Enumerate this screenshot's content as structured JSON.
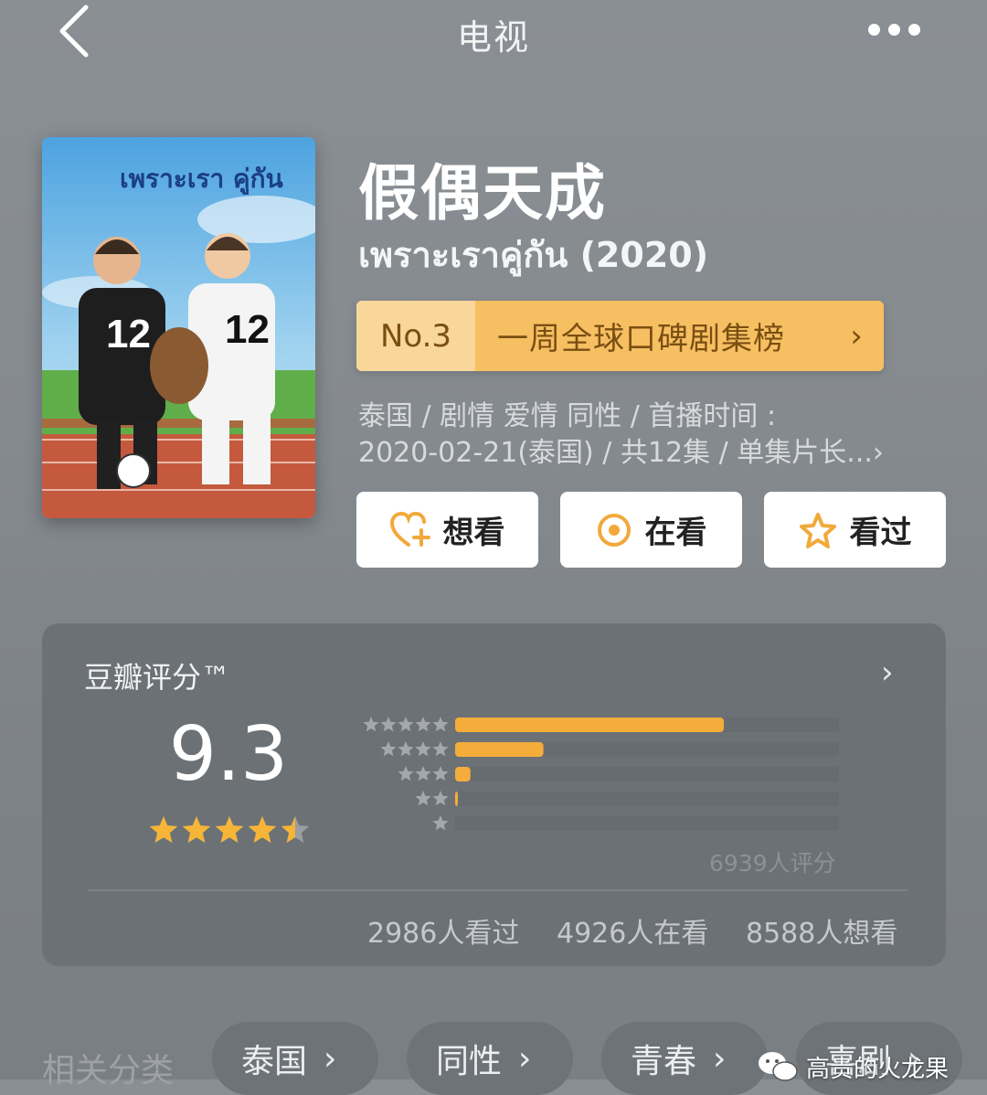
{
  "nav": {
    "title": "电视"
  },
  "show": {
    "title": "假偶天成",
    "original_title": "เพราะเราคู่กัน (2020)",
    "poster": {
      "logo_text": "เพราะเรา คู่กัน",
      "jersey_number": "12"
    }
  },
  "rank": {
    "no": "No.3",
    "label": "一周全球口碑剧集榜"
  },
  "meta": {
    "line1": "泰国 / 剧情 爱情 同性 / 首播时间 :",
    "line2": "2020-02-21(泰国) / 共12集 / 单集片长...",
    "chevron": "›"
  },
  "actions": [
    {
      "label": "想看",
      "icon": "heart-plus-icon"
    },
    {
      "label": "在看",
      "icon": "target-circle-icon"
    },
    {
      "label": "看过",
      "icon": "star-outline-icon"
    }
  ],
  "rating": {
    "title": "豆瓣评分™",
    "score": "9.3",
    "stars": 4.5,
    "distribution": [
      {
        "stars": 5,
        "fraction": 0.7
      },
      {
        "stars": 4,
        "fraction": 0.23
      },
      {
        "stars": 3,
        "fraction": 0.04
      },
      {
        "stars": 2,
        "fraction": 0.004
      },
      {
        "stars": 1,
        "fraction": 0.0
      }
    ],
    "votes_text": "6939人评分",
    "watched": "2986人看过",
    "watching": "4926人在看",
    "want": "8588人想看"
  },
  "related": {
    "label": "相关分类",
    "chips": [
      "泰国",
      "同性",
      "青春",
      "喜剧"
    ]
  },
  "watermark": {
    "text": "高贵的火龙果"
  },
  "colors": {
    "accent": "#f6bf62",
    "bar": "#f4ad3b",
    "star": "#f6b536",
    "card": "#6c7176"
  }
}
